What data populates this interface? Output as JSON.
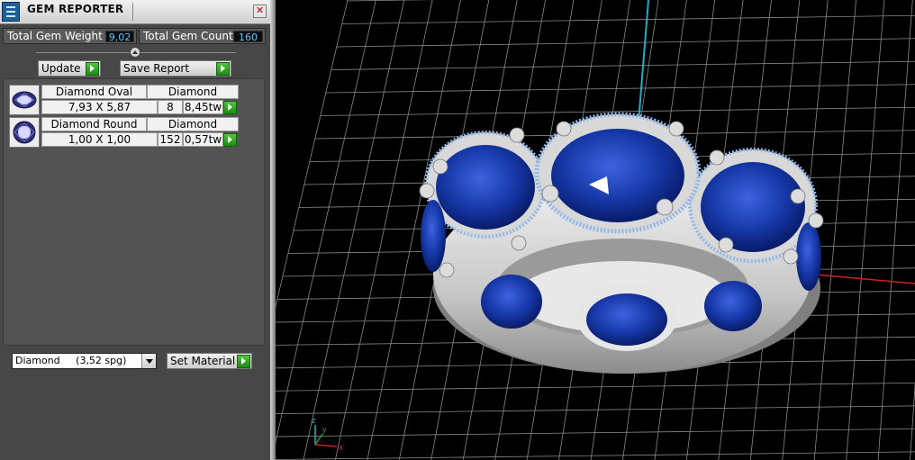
{
  "window": {
    "title": "GEM REPORTER",
    "close_symbol": "✕"
  },
  "stats": {
    "total_weight_label": "Total Gem Weight",
    "total_weight_value": "9,02",
    "total_count_label": "Total Gem Count",
    "total_count_value": "160"
  },
  "buttons": {
    "update": "Update",
    "save_report": "Save Report",
    "set_material": "Set Material"
  },
  "gems": [
    {
      "name": "Diamond Oval",
      "material": "Diamond",
      "size": "7,93 X 5,87",
      "count": "8",
      "weight": "8,45tw"
    },
    {
      "name": "Diamond Round",
      "material": "Diamond",
      "size": "1,00 X 1,00",
      "count": "152",
      "weight": "0,57tw"
    }
  ],
  "material_select": {
    "value": "Diamond     (3,52 spg)"
  },
  "viewport": {
    "axis_labels": {
      "x": "x",
      "y": "y",
      "z": "z"
    },
    "colors": {
      "background": "#000000",
      "grid": "#8a8a8a",
      "metal": "#d4d4d4",
      "gem_blue": "#1436a6",
      "pave_blue": "#8fb6e8",
      "axis_red": "#d02020",
      "axis_cyan": "#1ab0c8"
    }
  }
}
